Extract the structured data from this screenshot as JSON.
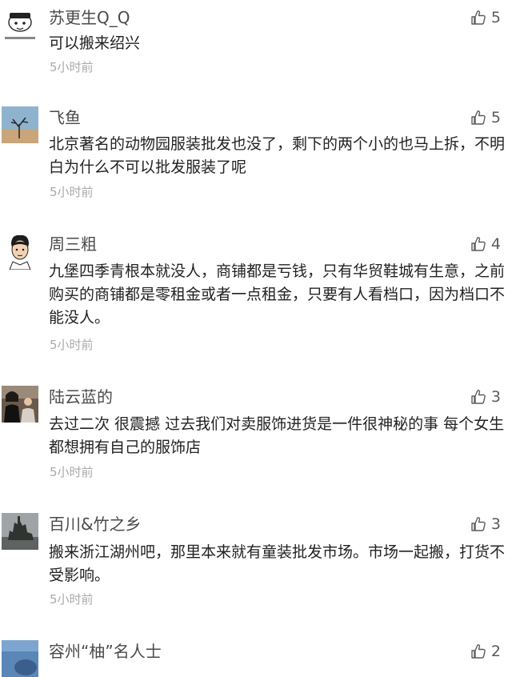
{
  "comments": [
    {
      "username": "苏更生Q_Q",
      "text": "可以搬来绍兴",
      "time": "5小时前",
      "likes": "5",
      "avatar_icon": "cartoon-avatar"
    },
    {
      "username": "飞鱼",
      "text": "北京著名的动物园服装批发也没了，剩下的两个小的也马上拆，不明白为什么不可以批发服装了呢",
      "time": "5小时前",
      "likes": "5",
      "avatar_icon": "desert-tree-avatar"
    },
    {
      "username": "周三粗",
      "text": "九堡四季青根本就没人，商铺都是亏钱，只有华贸鞋城有生意，之前购买的商铺都是零租金或者一点租金，只要有人看档口，因为档口不能没人。",
      "time": "5小时前",
      "likes": "4",
      "avatar_icon": "cartoon-man-avatar"
    },
    {
      "username": "陆云蓝的",
      "text": "去过二次 很震撼 过去我们对卖服饰进货是一件很神秘的事 每个女生都想拥有自己的服饰店",
      "time": "5小时前",
      "likes": "3",
      "avatar_icon": "photo-people-avatar"
    },
    {
      "username": "百川&竹之乡",
      "text": "搬来浙江湖州吧，那里本来就有童装批发市场。市场一起搬，打货不受影响。",
      "time": "5小时前",
      "likes": "3",
      "avatar_icon": "statue-avatar"
    },
    {
      "username": "容州“柚”名人士",
      "text": "",
      "time": "",
      "likes": "2",
      "avatar_icon": "sky-photo-avatar"
    }
  ],
  "colors": {
    "username": "#4a4a4a",
    "text": "#222222",
    "time": "#a9a9a9",
    "like": "#5c5c5c"
  },
  "icons": {
    "like": "thumbs-up-icon"
  }
}
